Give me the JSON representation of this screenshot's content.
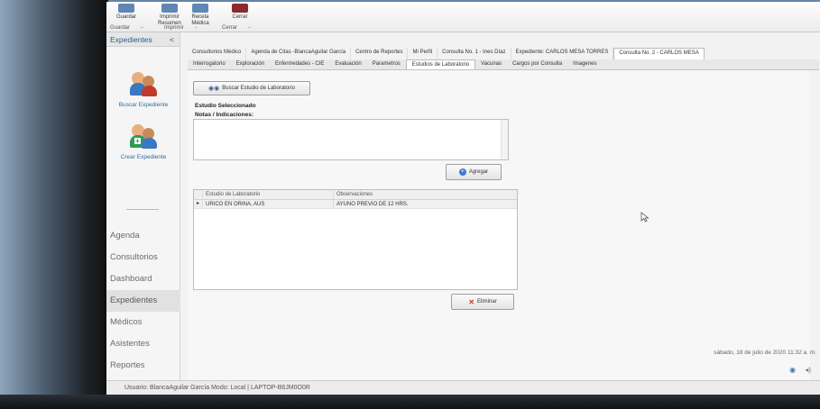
{
  "ribbon": {
    "buttons": [
      {
        "label": "Guardar"
      },
      {
        "label": "Imprimir Resumen"
      },
      {
        "label": "Receta Médica"
      },
      {
        "label": "Cerrar"
      }
    ],
    "groups": [
      {
        "label": "Guardar"
      },
      {
        "label": "Imprimir"
      },
      {
        "label": "Cerrar"
      }
    ]
  },
  "sidebar": {
    "header": "Expedientes",
    "collapse_glyph": "<",
    "tools": [
      {
        "label": "Buscar Expediente",
        "icon": "doctors-search-icon"
      },
      {
        "label": "Crear Expediente",
        "icon": "doctors-add-icon"
      }
    ],
    "nav": [
      {
        "label": "Agenda"
      },
      {
        "label": "Consultorios"
      },
      {
        "label": "Dashboard"
      },
      {
        "label": "Expedientes",
        "active": true
      },
      {
        "label": "Médicos"
      },
      {
        "label": "Asistentes"
      },
      {
        "label": "Reportes"
      }
    ],
    "more": "..."
  },
  "doc_tabs": [
    "Consultorios Médico",
    "Agenda de Citas -BlancaAguilar García",
    "Centro de Reportes",
    "Mi Perfil",
    "Consulta No. 1 - Ines Díaz",
    "Expediente: CARLOS MESA TORRES",
    "Consulta No. 2 - CARLOS MESA"
  ],
  "doc_tab_active": 6,
  "sub_tabs": [
    "Interrogatorio",
    "Exploración",
    "Enfermedades - CIE",
    "Evaluación",
    "Parametros",
    "Estudios de Laboratorio",
    "Vacunas",
    "Cargos por Consulta",
    "Imagenes"
  ],
  "sub_tab_active": 5,
  "panel": {
    "search_button": "Buscar Estudio de Laboratorio",
    "selected_label": "Estudio Seleccionado",
    "notes_label": "Notas / Indicaciones:",
    "add_button": "Agregar",
    "delete_button": "Eliminar",
    "grid": {
      "columns": [
        "Estudio de Laboratorio",
        "Observaciones"
      ],
      "rows": [
        {
          "indicator": "▸",
          "estudio": "URICO EN ORINA, AUS",
          "observaciones": "AYUNO PREVIO DE 12 HRS."
        }
      ]
    }
  },
  "status": {
    "text": "Usuario: BlancaAguilar García      Modo: Local | LAPTOP-B6JM0O0R"
  },
  "clock": "sábado, 18 de julio de 2020   11:32 a. m."
}
